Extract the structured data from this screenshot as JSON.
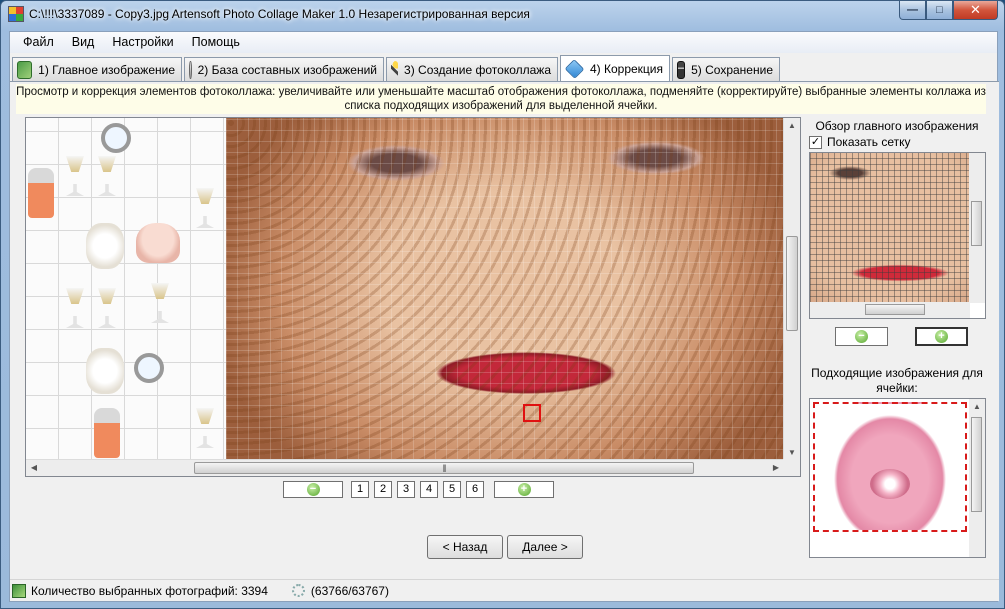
{
  "window": {
    "title": "C:\\!!!\\3337089 - Copy3.jpg Artensoft Photo Collage Maker 1.0  Незарегистрированная версия",
    "minimize_glyph": "—",
    "maximize_glyph": "□",
    "close_glyph": "✕"
  },
  "menu": {
    "items": [
      "Файл",
      "Вид",
      "Настройки",
      "Помощь"
    ]
  },
  "tabs": [
    {
      "label": "1) Главное изображение",
      "icon": "main-image-icon"
    },
    {
      "label": "2) База составных изображений",
      "icon": "database-icon"
    },
    {
      "label": "3) Создание фотоколлажа",
      "icon": "magic-wand-icon"
    },
    {
      "label": "4) Коррекция",
      "icon": "cube-icon",
      "active": true
    },
    {
      "label": "5) Сохранение",
      "icon": "floppy-disk-icon"
    }
  ],
  "instructions": "Просмотр и коррекция элементов фотоколлажа: увеличивайте или уменьшайте масштаб отображения фотоколлажа, подменяйте (корректируйте) выбранные элементы коллажа из списка подходящих изображений для выделенной ячейки.",
  "scroll": {
    "up_glyph": "▲",
    "down_glyph": "▼",
    "left_glyph": "◀",
    "right_glyph": "▶",
    "grip_glyph": "|||"
  },
  "pager": {
    "zoom_out_glyph": "−",
    "zoom_in_glyph": "+",
    "pages": [
      "1",
      "2",
      "3",
      "4",
      "5",
      "6"
    ]
  },
  "nav": {
    "back_label": "< Назад",
    "next_label": "Далее >"
  },
  "right_panel": {
    "overview_title": "Обзор главного изображения",
    "show_grid_label": "Показать сетку",
    "show_grid_checked": true,
    "checkbox_glyph": "✓",
    "candidates_title": "Подходящие изображения для ячейки:"
  },
  "status": {
    "selected_count": "Количество выбранных фотографий: 3394",
    "progress": "(63766/63767)"
  },
  "colors": {
    "selection": "#e01010",
    "accent": "#55a52c"
  }
}
